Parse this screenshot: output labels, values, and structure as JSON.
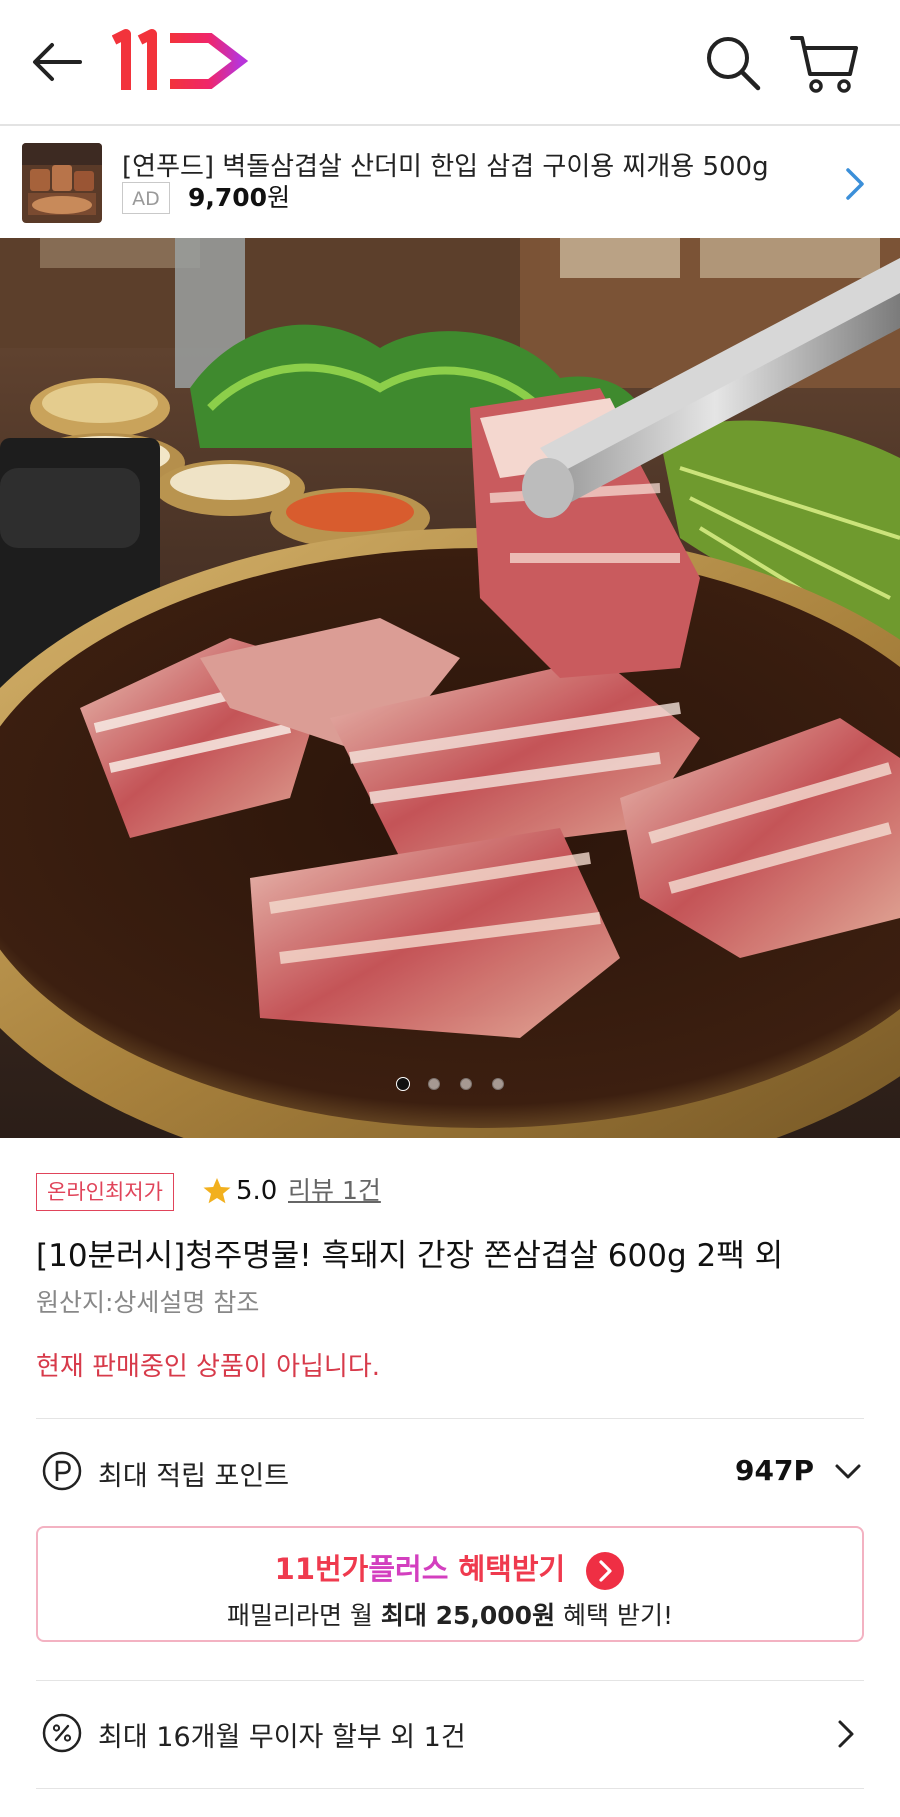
{
  "header": {
    "back_icon": "arrow-left-icon",
    "logo_text": "11",
    "search_icon": "search-icon",
    "cart_icon": "cart-icon"
  },
  "ad_banner": {
    "title": "[연푸드] 벽돌삼겹살 산더미 한입 삼겹 구이용 찌개용 500g",
    "badge": "AD",
    "price": "9,700",
    "currency": "원",
    "chevron_icon": "chevron-right-icon"
  },
  "gallery": {
    "image_count": 4,
    "active_index": 0
  },
  "product": {
    "badge": "온라인최저가",
    "rating": "5.0",
    "review_link": "리뷰 1건",
    "title": "[10분러시]청주명물! 흑돼지 간장 쫀삼겹살 600g 2팩 외",
    "origin": "원산지:상세설명 참조",
    "status": "현재 판매중인 상품이 아닙니다."
  },
  "points": {
    "icon": "p-circle-icon",
    "label": "최대 적립 포인트",
    "value": "947P"
  },
  "plus_promo": {
    "brand_prefix": "11번가",
    "brand_plus": "플러스",
    "action": " 혜택받기",
    "sub_prefix": "패밀리라면 월 ",
    "sub_bold": "최대 25,000원",
    "sub_suffix": " 혜택 받기!"
  },
  "installment": {
    "icon": "percent-circle-icon",
    "label": "최대 16개월 무이자 할부 외 1건"
  },
  "colors": {
    "accent_red": "#ef3a4e",
    "accent_magenta": "#d33fbf",
    "status_red": "#d73a4a",
    "badge_border": "#e0445a"
  }
}
